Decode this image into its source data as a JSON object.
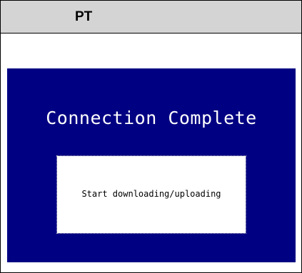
{
  "window": {
    "title": "PT"
  },
  "screen": {
    "title": "Connection Complete",
    "message": "Start downloading/uploading",
    "background_color": "#000082",
    "message_box_color": "#ffffff"
  }
}
